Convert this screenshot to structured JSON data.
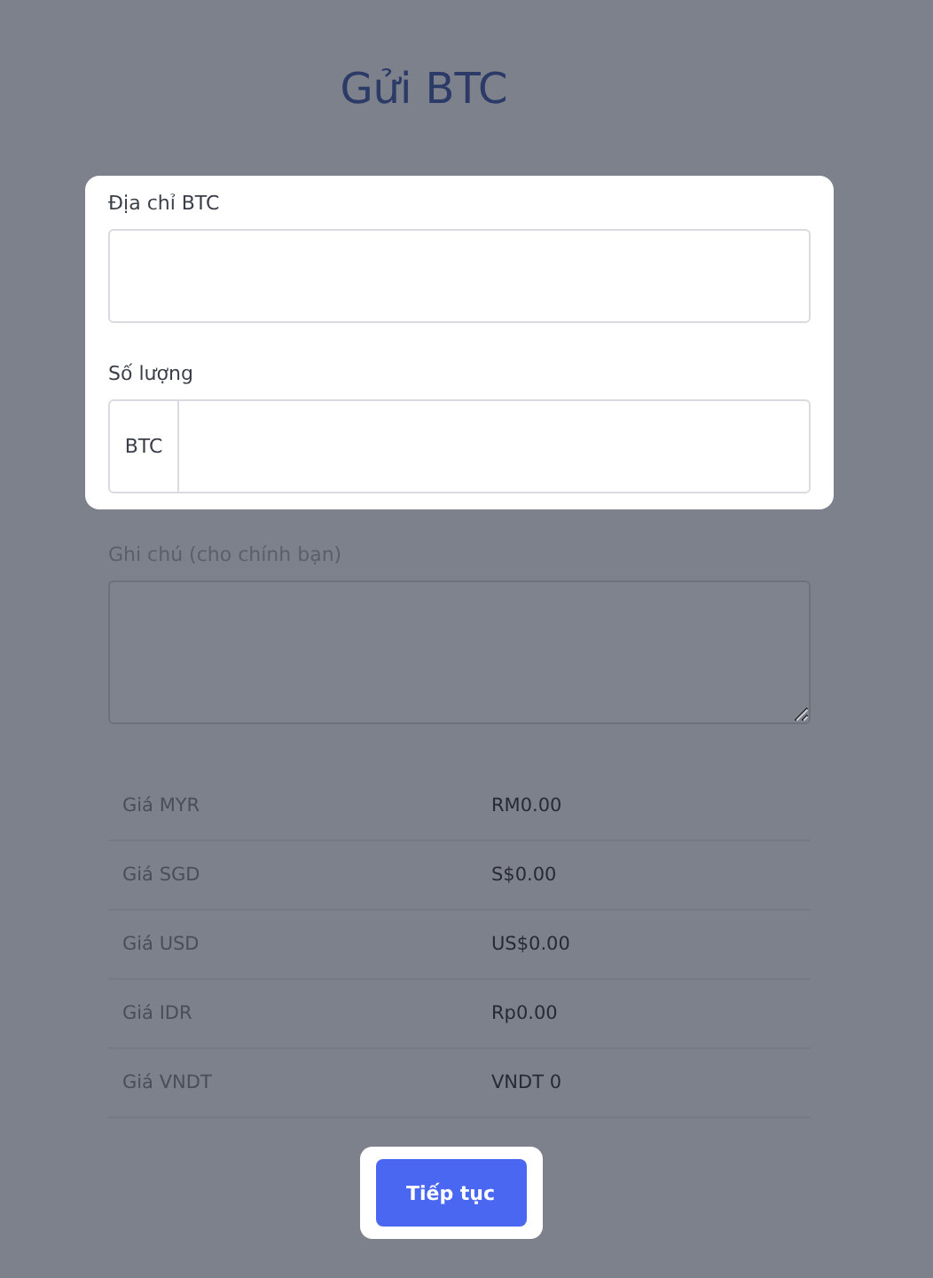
{
  "title": "Gửi BTC",
  "sections": [
    {
      "highlighted": true,
      "fields": [
        {
          "kind": "text",
          "label": "Địa chỉ BTC"
        },
        {
          "kind": "addon",
          "label": "Số lượng",
          "addon": "BTC"
        }
      ]
    },
    {
      "highlighted": false,
      "fields": [
        {
          "kind": "textarea",
          "label": "Ghi chú (cho chính bạn)"
        }
      ]
    }
  ],
  "prices": [
    {
      "label": "Giá MYR",
      "value": "RM0.00"
    },
    {
      "label": "Giá SGD",
      "value": "S$0.00"
    },
    {
      "label": "Giá USD",
      "value": "US$0.00"
    },
    {
      "label": "Giá IDR",
      "value": "Rp0.00"
    },
    {
      "label": "Giá VNDT",
      "value": "VNDT 0"
    }
  ],
  "button": {
    "label": "Tiếp tục",
    "highlighted": true
  }
}
